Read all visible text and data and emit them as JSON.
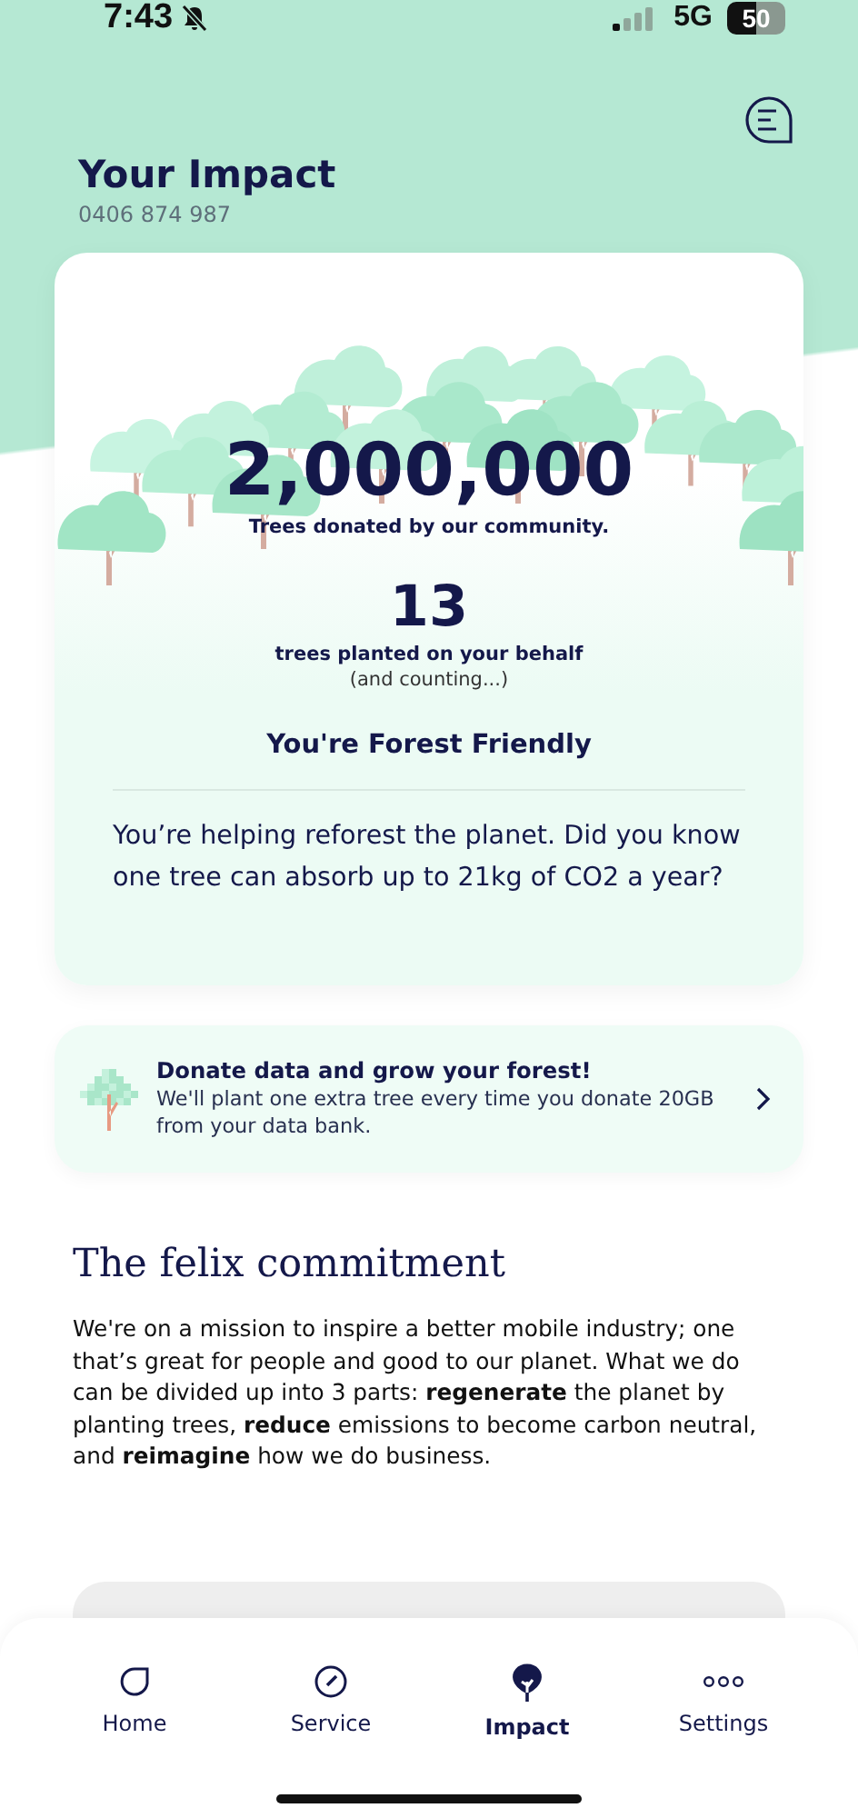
{
  "status_bar": {
    "time": "7:43",
    "network": "5G",
    "battery": "50"
  },
  "header": {
    "title": "Your Impact",
    "phone": "0406 874 987"
  },
  "impact_card": {
    "community_total": "2,000,000",
    "community_caption": "Trees donated by our community.",
    "your_total": "13",
    "your_caption": "trees planted on your behalf",
    "your_note": "(and counting...)",
    "status": "You're Forest Friendly",
    "message": "You’re helping reforest the planet. Did you know one tree can absorb up to 21kg of CO2 a year?"
  },
  "donate_card": {
    "title": "Donate data and grow your forest!",
    "text": "We'll plant one extra tree every time you donate 20GB from your data bank."
  },
  "commitment": {
    "title": "The felix commitment",
    "text": "We're on a mission to inspire a better mobile industry; one that’s great for people and good to our planet. What we do can be divided up into 3 parts: **regenerate** the planet by planting trees, **reduce** emissions to become carbon neutral, and **reimagine** how we do business."
  },
  "tab_bar": [
    {
      "kind": "home",
      "label": "Home",
      "selected": false
    },
    {
      "kind": "service",
      "label": "Service",
      "selected": false
    },
    {
      "kind": "impact",
      "label": "Impact",
      "selected": true
    },
    {
      "kind": "settings",
      "label": "Settings",
      "selected": false
    }
  ]
}
